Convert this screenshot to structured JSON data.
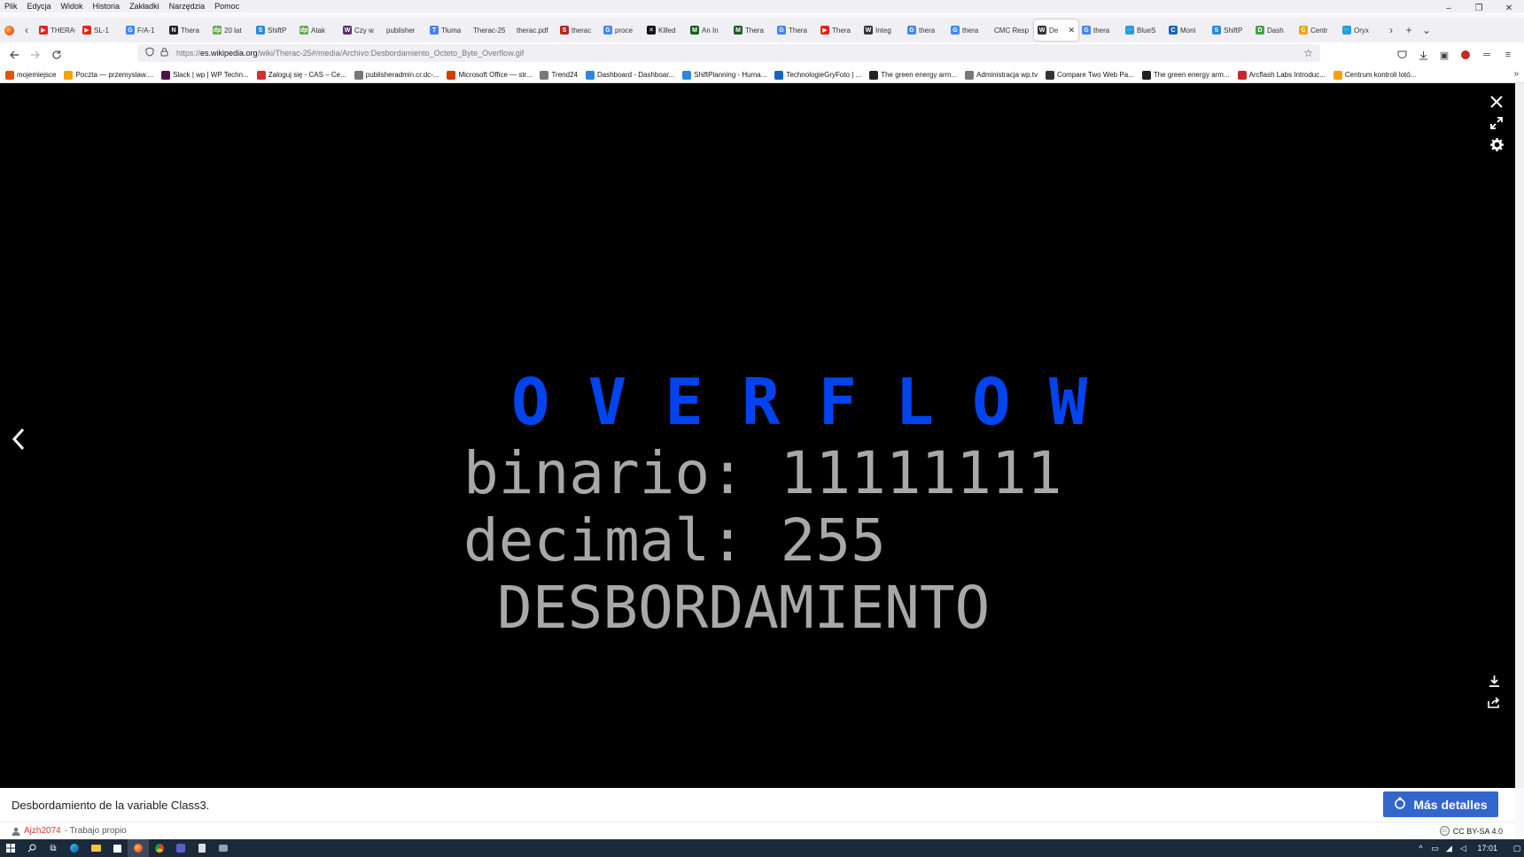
{
  "menubar": {
    "items": [
      "Plik",
      "Edycja",
      "Widok",
      "Historia",
      "Zakładki",
      "Narzędzia",
      "Pomoc"
    ]
  },
  "window_controls": {
    "minimize": "–",
    "restore": "❐",
    "close": "✕"
  },
  "tabs": [
    {
      "label": "THERAC",
      "color": "#e62117",
      "glyph": "▶"
    },
    {
      "label": "SL-1",
      "color": "#e62117",
      "glyph": "▶"
    },
    {
      "label": "F/A-1",
      "color": "#4285f4",
      "glyph": "G"
    },
    {
      "label": "Thera",
      "color": "#222222",
      "glyph": "N"
    },
    {
      "label": "20 lat",
      "color": "#6aa84f",
      "glyph": "dp"
    },
    {
      "label": "ShiftP",
      "color": "#2b88d8",
      "glyph": "S"
    },
    {
      "label": "Atak",
      "color": "#6aa84f",
      "glyph": "dp"
    },
    {
      "label": "Czy w",
      "color": "#5b2c6f",
      "glyph": "W"
    },
    {
      "label": "publisher",
      "color": "#ffffff",
      "glyph": ""
    },
    {
      "label": "Tłuma",
      "color": "#4285f4",
      "glyph": "T"
    },
    {
      "label": "Therac-25",
      "color": "#ffffff",
      "glyph": ""
    },
    {
      "label": "therac.pdf",
      "color": "#ffffff",
      "glyph": ""
    },
    {
      "label": "therac",
      "color": "#b3261e",
      "glyph": "S"
    },
    {
      "label": "proce",
      "color": "#4285f4",
      "glyph": "G"
    },
    {
      "label": "Killed",
      "color": "#111111",
      "glyph": "✕"
    },
    {
      "label": "An In",
      "color": "#1b5e20",
      "glyph": "M"
    },
    {
      "label": "Thera",
      "color": "#1b5e20",
      "glyph": "M"
    },
    {
      "label": "Thera",
      "color": "#4285f4",
      "glyph": "G"
    },
    {
      "label": "Thera",
      "color": "#e62117",
      "glyph": "▶"
    },
    {
      "label": "Integ",
      "color": "#333333",
      "glyph": "W"
    },
    {
      "label": "thera",
      "color": "#4285f4",
      "glyph": "G"
    },
    {
      "label": "thera",
      "color": "#4285f4",
      "glyph": "G"
    },
    {
      "label": "CMC Resp",
      "color": "#ffffff",
      "glyph": ""
    },
    {
      "label": "De",
      "color": "#333333",
      "glyph": "W",
      "active": true
    },
    {
      "label": "thera",
      "color": "#4285f4",
      "glyph": "G"
    },
    {
      "label": "BlueS",
      "color": "#1d9bf0",
      "glyph": "🐦"
    },
    {
      "label": "Moni",
      "color": "#1565c0",
      "glyph": "C"
    },
    {
      "label": "ShiftP",
      "color": "#2b88d8",
      "glyph": "S"
    },
    {
      "label": "Dash",
      "color": "#43a047",
      "glyph": "D"
    },
    {
      "label": "Centr",
      "color": "#f4a300",
      "glyph": "C"
    },
    {
      "label": "Oryx",
      "color": "#1d9bf0",
      "glyph": "🐦"
    }
  ],
  "tab_strip": {
    "scroll_left": "‹",
    "scroll_right": "›",
    "new_tab": "+",
    "list_all": "⌄"
  },
  "navbar": {
    "url_host": "es.wikipedia.org",
    "url_prefix": "https://",
    "url_path": "/wiki/Therac-25#/media/Archivo:Desbordamiento_Octeto_Byte_Overflow.gif"
  },
  "bookmarks": [
    {
      "label": "mojemiejsce",
      "color": "#e65100"
    },
    {
      "label": "Poczta — przemyslaw....",
      "color": "#f4a300"
    },
    {
      "label": "Slack | wp | WP Techn...",
      "color": "#4a154b"
    },
    {
      "label": "Zaloguj się - CAS – Ce...",
      "color": "#d32f2f"
    },
    {
      "label": "publisheradmin.cr.dc-...",
      "color": "#777777"
    },
    {
      "label": "Microsoft Office — str...",
      "color": "#d83b01"
    },
    {
      "label": "Trend24",
      "color": "#777777"
    },
    {
      "label": "Dashboard - Dashboar...",
      "color": "#2b88d8"
    },
    {
      "label": "ShiftPlanning - Huma...",
      "color": "#2b88d8"
    },
    {
      "label": "TechnologieGryFoto | ...",
      "color": "#1565c0"
    },
    {
      "label": "The green energy arm...",
      "color": "#222222"
    },
    {
      "label": "Administracja wp.tv",
      "color": "#777777"
    },
    {
      "label": "Compare Two Web Pa...",
      "color": "#333333"
    },
    {
      "label": "The green energy arm...",
      "color": "#222222"
    },
    {
      "label": "Arcflash Labs Introduc...",
      "color": "#c62828"
    },
    {
      "label": "Centrum kontroli lotó...",
      "color": "#f4a300"
    }
  ],
  "viewer": {
    "title": "O V E R F L O W",
    "binary_line": "binario: 11111111",
    "decimal_line": "decimal: 255",
    "overflow_line": "DESBORDAMIENTO",
    "caption": "Desbordamiento de la variable Class3.",
    "more_details": "Más detalles",
    "author": "Ajzh2074",
    "author_suffix": "- Trabajo propio",
    "license": "CC BY-SA 4.0",
    "title_color": "#0044ee",
    "text_color": "#a8a8a8"
  },
  "taskbar": {
    "clock": "17:01"
  }
}
